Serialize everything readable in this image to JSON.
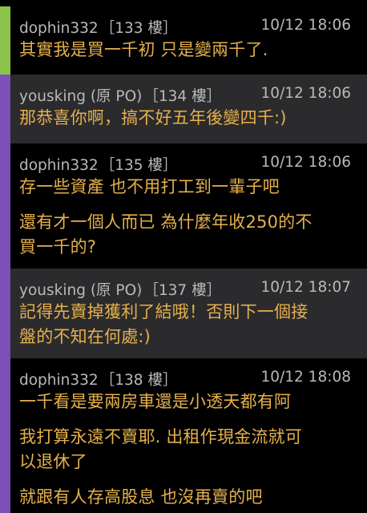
{
  "colors": {
    "accent_green": "#8bc34a",
    "accent_purple": "#7d4fb8",
    "header_text": "#b9b9b9",
    "body_text": "#e6b04c",
    "dark_bg": "#000000",
    "gray_bg": "#2b2b2d"
  },
  "posts": [
    {
      "author": "dophin332",
      "floor": "［133 樓］",
      "time": "10/12 18:06",
      "lines": [
        "其實我是買一千初 只是變兩千了."
      ]
    },
    {
      "author": "yousking (原 PO)",
      "floor": "［134 樓］",
      "time": "10/12 18:06",
      "lines": [
        "那恭喜你啊，搞不好五年後變四千:)"
      ]
    },
    {
      "author": "dophin332",
      "floor": "［135 樓］",
      "time": "10/12 18:06",
      "lines": [
        "存一些資產  也不用打工到一輩子吧",
        "還有才一個人而已 為什麼年收250的不",
        "買一千的?"
      ]
    },
    {
      "author": "yousking (原 PO)",
      "floor": "［137 樓］",
      "time": "10/12 18:07",
      "lines": [
        "記得先賣掉獲利了結哦！否則下一個接",
        "盤的不知在何處:)"
      ]
    },
    {
      "author": "dophin332",
      "floor": "［138 樓］",
      "time": "10/12 18:08",
      "lines": [
        "一千看是要兩房車還是小透天都有阿",
        "我打算永遠不賣耶. 出租作現金流就可",
        "以退休了",
        "就跟有人存高股息 也沒再賣的吧"
      ]
    }
  ]
}
